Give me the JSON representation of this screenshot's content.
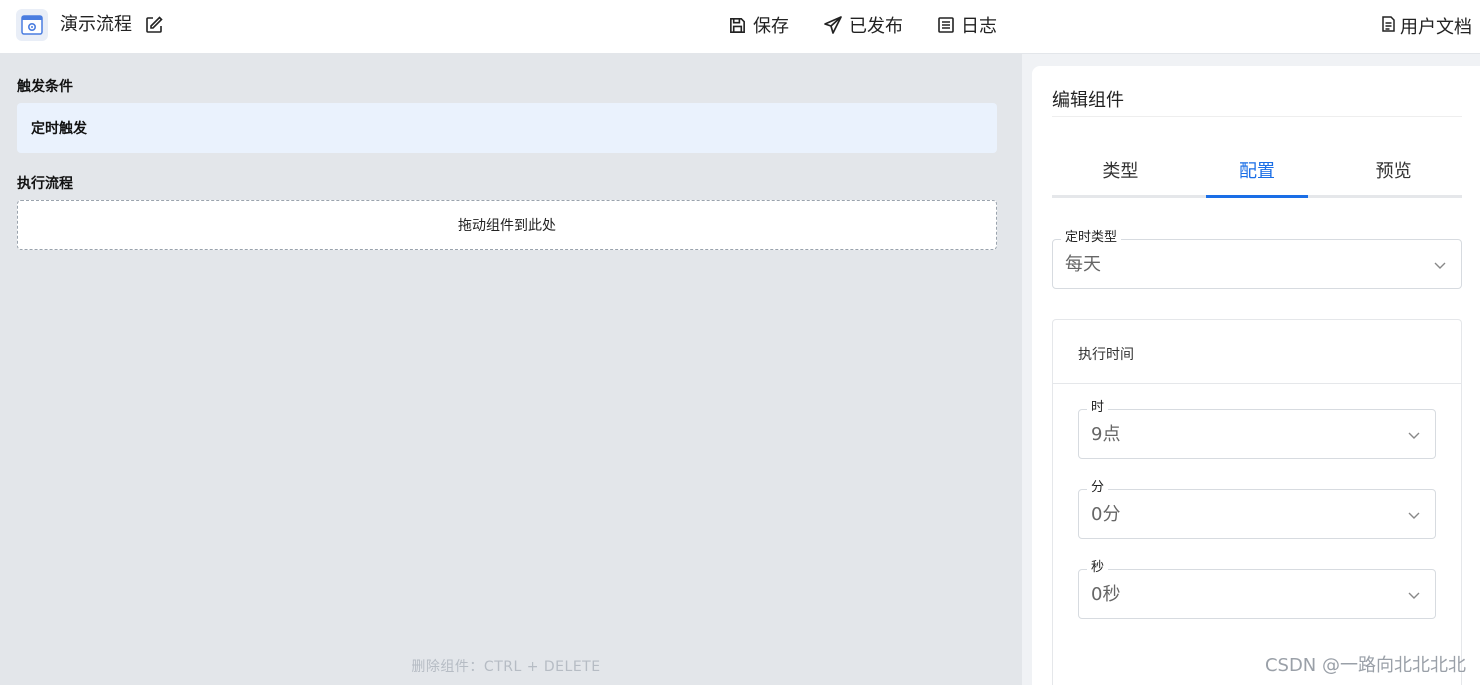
{
  "header": {
    "title": "演示流程",
    "save_label": "保存",
    "publish_label": "已发布",
    "log_label": "日志",
    "docs_label": "用户文档"
  },
  "canvas": {
    "trigger_section_label": "触发条件",
    "trigger_item": "定时触发",
    "flow_section_label": "执行流程",
    "drop_placeholder": "拖动组件到此处",
    "hint": "删除组件：CTRL + DELETE"
  },
  "panel": {
    "title": "编辑组件",
    "tabs": [
      {
        "label": "类型",
        "active": false
      },
      {
        "label": "配置",
        "active": true
      },
      {
        "label": "预览",
        "active": false
      }
    ],
    "timer_type": {
      "label": "定时类型",
      "value": "每天"
    },
    "exec_time": {
      "title": "执行时间",
      "hour": {
        "label": "时",
        "value": "9点"
      },
      "minute": {
        "label": "分",
        "value": "0分"
      },
      "second": {
        "label": "秒",
        "value": "0秒"
      }
    }
  },
  "watermark": "CSDN @一路向北北北北",
  "colors": {
    "accent": "#1a6ee6",
    "canvas_bg": "#e3e6ea",
    "trigger_bg": "#eaf2fd"
  }
}
